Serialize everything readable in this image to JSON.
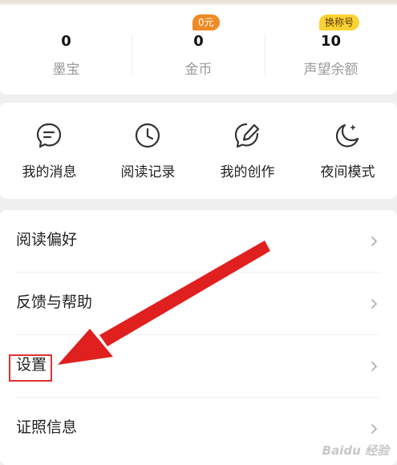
{
  "stats": [
    {
      "value": "0",
      "label": "墨宝",
      "badge": ""
    },
    {
      "value": "0",
      "label": "金币",
      "badge": "0元"
    },
    {
      "value": "10",
      "label": "声望余额",
      "badge": "换称号"
    }
  ],
  "colors": {
    "badge_coin_bg": "#f08a24",
    "badge_title_bg": "#fbd234",
    "annotation_red": "#e0201e"
  },
  "shortcuts": [
    {
      "label": "我的消息",
      "icon": "chat-bubble-icon"
    },
    {
      "label": "阅读记录",
      "icon": "clock-icon"
    },
    {
      "label": "我的创作",
      "icon": "pencil-bubble-icon"
    },
    {
      "label": "夜间模式",
      "icon": "moon-icon"
    }
  ],
  "menu": [
    {
      "label": "阅读偏好"
    },
    {
      "label": "反馈与帮助"
    },
    {
      "label": "设置"
    },
    {
      "label": "证照信息"
    }
  ],
  "watermark": "Baidu 经验"
}
